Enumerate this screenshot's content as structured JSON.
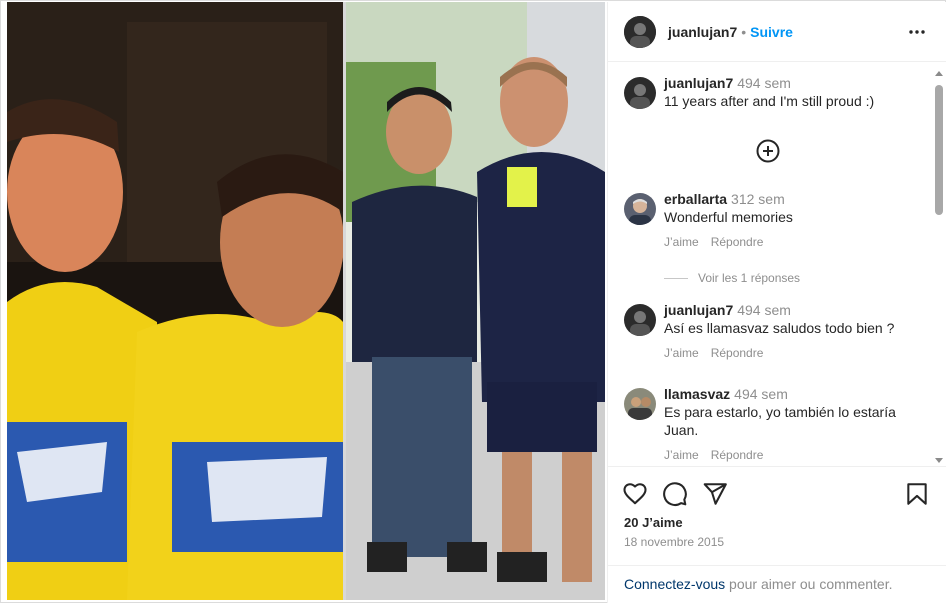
{
  "post": {
    "username": "juanlujan7",
    "dot": "•",
    "follow_label": "Suivre",
    "more_icon": "more-options-icon"
  },
  "comments": [
    {
      "username": "juanlujan7",
      "time": "494 sem",
      "text": "11 years after and I'm still proud :)",
      "is_caption": true
    },
    {
      "username": "erballarta",
      "time": "312 sem",
      "text": "Wonderful memories",
      "like_label": "J’aime",
      "reply_label": "Répondre"
    },
    {
      "username": "juanlujan7",
      "time": "494 sem",
      "text": "Así es llamasvaz saludos todo bien ?",
      "like_label": "J’aime",
      "reply_label": "Répondre"
    },
    {
      "username": "llamasvaz",
      "time": "494 sem",
      "text": "Es para estarlo, yo también lo estaría Juan.",
      "like_label": "J’aime",
      "reply_label": "Répondre"
    }
  ],
  "view_replies": "Voir les 1 réponses",
  "actions": {
    "icons": [
      "heart-icon",
      "comment-icon",
      "share-icon",
      "bookmark-icon"
    ],
    "likes": "20 J’aime",
    "date": "18 novembre 2015"
  },
  "login": {
    "link": "Connectez-vous",
    "text": " pour aimer ou commenter."
  },
  "colors": {
    "accent": "#0095f6",
    "text": "#262626",
    "muted": "#8e8e8e",
    "border": "#efefef",
    "jersey_yellow": "#f2d21a",
    "link_dark": "#00376b"
  }
}
